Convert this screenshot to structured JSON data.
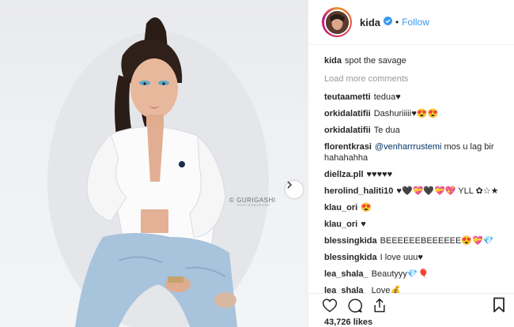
{
  "post": {
    "username": "kida",
    "follow_label": "Follow",
    "dot": "•",
    "watermark": "© GURIGASHI",
    "watermark_sub": "PHOTOGRAPHER",
    "likes": "43,726 likes"
  },
  "caption": {
    "user": "kida",
    "text": "spot the savage"
  },
  "load_more": "Load more comments",
  "comments": [
    {
      "user": "teutaametti",
      "text": "tedua♥"
    },
    {
      "user": "orkidalatifii",
      "text": "Dashuriiiii♥😍😍"
    },
    {
      "user": "orkidalatifii",
      "text": "Te dua"
    },
    {
      "user": "florentkrasi",
      "mention": "@venharrrustemi",
      "text": "mos u lag bir hahahahha"
    },
    {
      "user": "diellza.pll",
      "text": "♥♥♥♥♥"
    },
    {
      "user": "herolind_haliti10",
      "text": "♥🖤💝🖤💝💖 YLL ✿☆★"
    },
    {
      "user": "klau_ori",
      "text": "😍"
    },
    {
      "user": "klau_ori",
      "text": "♥"
    },
    {
      "user": "blessingkida",
      "text": "BEEEEEEBEEEEEE😍💝💎"
    },
    {
      "user": "blessingkida",
      "text": "I love uuu♥"
    },
    {
      "user": "lea_shala_",
      "text": "Beautyyy💎🎈"
    },
    {
      "user": "lea_shala_",
      "text": "Love💰"
    }
  ],
  "icons": {
    "like": "heart-icon",
    "comment": "comment-icon",
    "share": "share-icon",
    "save": "bookmark-icon",
    "verified": "verified-badge-icon",
    "next": "chevron-right-icon"
  },
  "colors": {
    "link": "#3897f0",
    "verified": "#3897f0",
    "text": "#262626",
    "muted": "#999999"
  }
}
